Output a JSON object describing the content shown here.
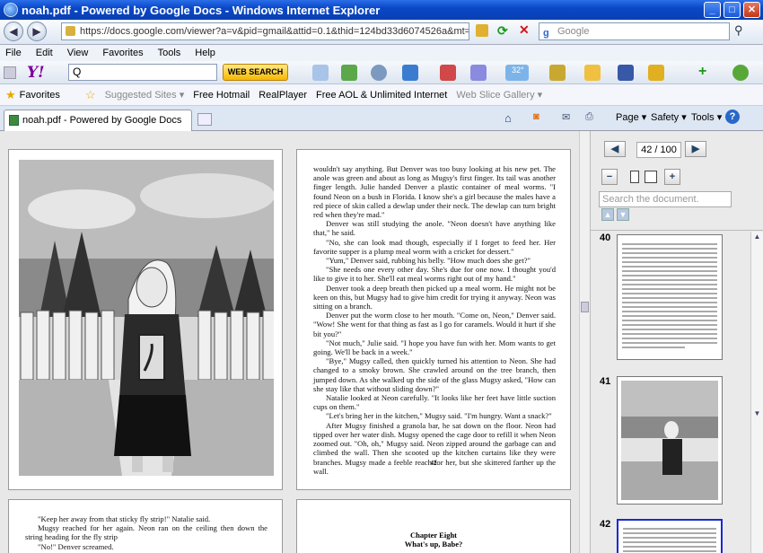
{
  "window": {
    "title": "noah.pdf - Powered by Google Docs - Windows Internet Explorer"
  },
  "address": {
    "url": "https://docs.google.com/viewer?a=v&pid=gmail&attid=0.1&thid=124bd33d6074526a&mt=application%2",
    "search_placeholder": "Google"
  },
  "menu": [
    "File",
    "Edit",
    "View",
    "Favorites",
    "Tools",
    "Help"
  ],
  "yahoo": {
    "logo": "Y!",
    "search_icon": "Q",
    "web_search": "WEB SEARCH",
    "weather": "32°"
  },
  "favorites": {
    "label": "Favorites",
    "items": [
      "Suggested Sites ▾",
      "Free Hotmail",
      "RealPlayer",
      "Free AOL & Unlimited Internet",
      "Web Slice Gallery ▾"
    ]
  },
  "tab": {
    "label": "noah.pdf - Powered by Google Docs"
  },
  "commands": {
    "page": "Page ▾",
    "safety": "Safety ▾",
    "tools": "Tools ▾"
  },
  "viewer": {
    "page_indicator": "42 / 100",
    "search_placeholder": "Search the document.",
    "thumbnails": [
      "40",
      "41",
      "42"
    ],
    "page42_number": "42",
    "page42_paragraphs": [
      "wouldn't say anything. But Denver was too busy looking at his new pet. The anole was green and about as long as Mugsy's first finger. Its tail was another finger length. Julie handed Denver a plastic container of meal worms. \"I found Neon on a bush in Florida. I know she's a girl because the males have a red piece of skin called a dewlap under their neck. The dewlap can turn bright red when they're mad.\"",
      "Denver was still studying the anole. \"Neon doesn't have anything like that,\" he said.",
      "\"No, she can look mad though, especially if I forget to feed her. Her favorite supper is a plump meal worm with a cricket for dessert.\"",
      "\"Yum,\" Denver said, rubbing his belly. \"How much does she get?\"",
      "\"She needs one every other day. She's due for one now. I thought you'd like to give it to her. She'll eat meal worms right out of my hand.\"",
      "Denver took a deep breath then picked up a meal worm. He might not be keen on this, but Mugsy had to give him credit for trying it anyway. Neon was sitting on a branch.",
      "Denver put the worm close to her mouth. \"Come on, Neon,\" Denver said. \"Wow! She went for that thing as fast as I go for caramels. Would it hurt if she bit you?\"",
      "\"Not much,\" Julie said. \"I hope you have fun with her. Mom wants to get going. We'll be back in a week.\"",
      "\"Bye,\" Mugsy called, then quickly turned his attention to Neon. She had changed to a smoky brown. She crawled around on the tree branch, then jumped down. As she walked up the side of the glass Mugsy asked, \"How can she stay like that without sliding down?\"",
      "Natalie looked at Neon carefully. \"It looks like her feet have little suction cups on them.\"",
      "\"Let's bring her in the kitchen,\" Mugsy said. \"I'm hungry. Want a snack?\"",
      "After Mugsy finished a granola bar, he sat down on the floor. Neon had tipped over her water dish. Mugsy opened the cage door to refill it when Neon zoomed out. \"Oh, oh,\" Mugsy said. Neon zipped around the garbage can and climbed the wall. Then she scooted up the kitchen curtains like they were branches. Mugsy made a feeble reach for her, but she skittered farther up the wall."
    ],
    "page43_left": [
      "\"Keep her away from that sticky fly strip!\" Natalie said.",
      "Mugsy reached for her again. Neon ran on the ceiling then down the string heading for the fly strip",
      "\"No!\" Denver screamed."
    ],
    "page43_right": [
      "Chapter Eight",
      "What's up, Babe?"
    ]
  }
}
